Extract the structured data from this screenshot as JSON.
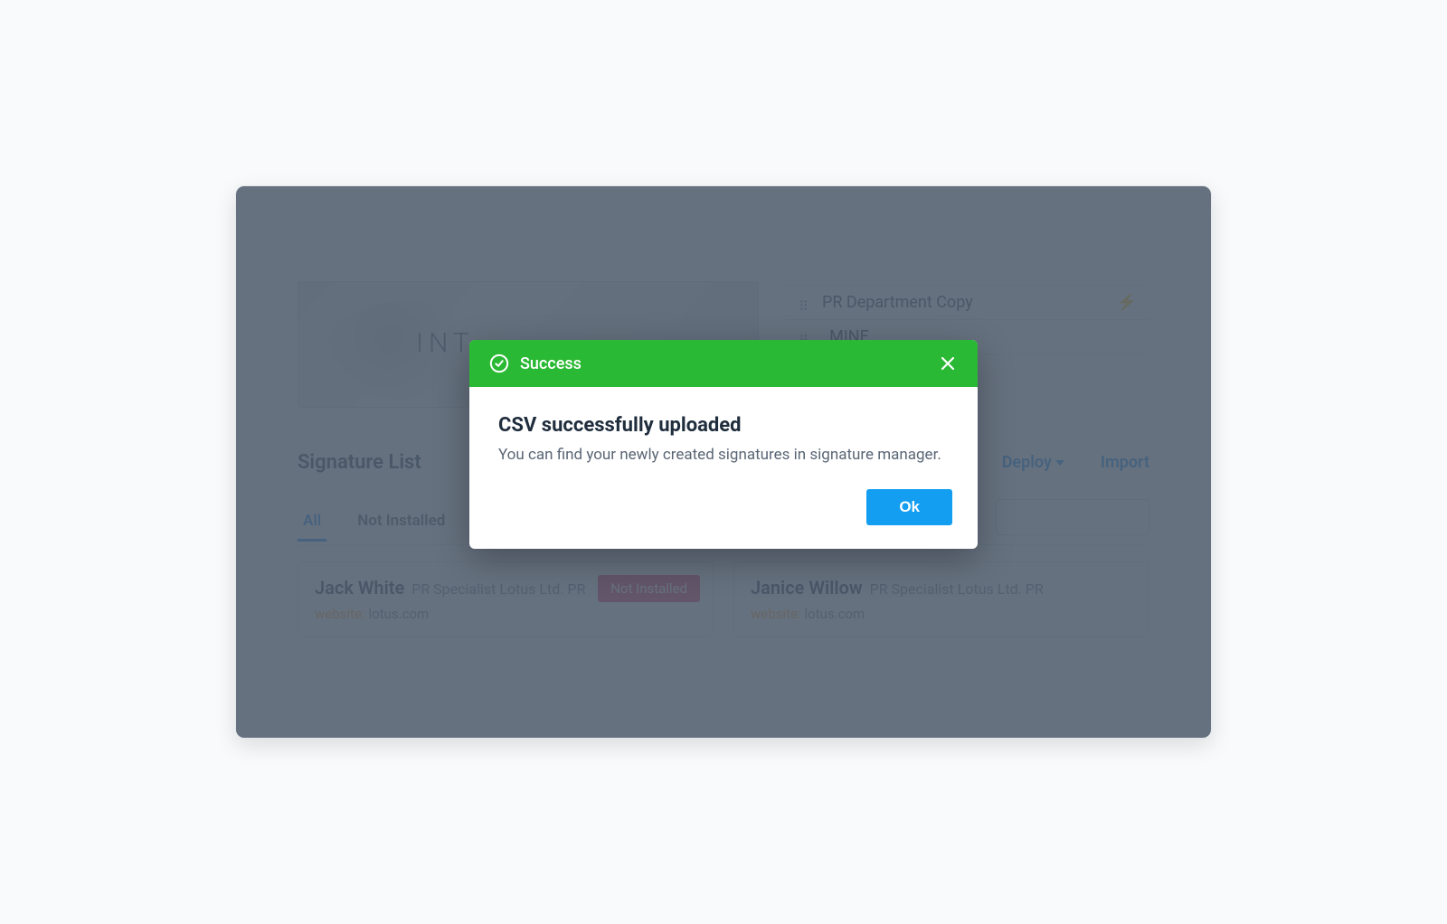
{
  "hero": {
    "text": "INT"
  },
  "departments": {
    "items": [
      {
        "label": "PR Department Copy",
        "has_bolt": true
      },
      {
        "label": "_MINE",
        "has_bolt": false
      }
    ]
  },
  "list": {
    "title": "Signature List",
    "deploy_label": "Deploy",
    "import_label": "Import"
  },
  "tabs": {
    "all": "All",
    "not_installed": "Not Installed"
  },
  "signatures": [
    {
      "name": "Jack White",
      "role": "PR Specialist Lotus Ltd. PR",
      "website_label": "website:",
      "website": "lotus.com",
      "badge": "Not Installed"
    },
    {
      "name": "Janice Willow",
      "role": "PR Specialist Lotus Ltd. PR",
      "website_label": "website:",
      "website": "lotus.com",
      "badge": null
    }
  ],
  "modal": {
    "header": "Success",
    "title": "CSV successfully uploaded",
    "body": "You can find your newly created signatures in signature manager.",
    "ok_label": "Ok"
  }
}
